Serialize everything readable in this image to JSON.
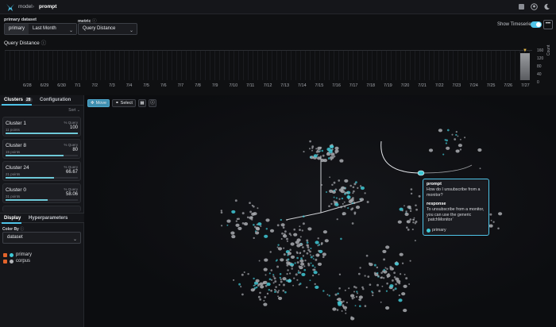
{
  "nav": {
    "breadcrumb": [
      "model",
      "prompt"
    ],
    "separator": "›"
  },
  "controls": {
    "primary_dataset_label": "primary dataset",
    "primary_tag": "primary",
    "primary_value": "Last Month",
    "metric_label": "metric",
    "metric_value": "Query Distance",
    "show_timeseries_label": "Show Timeseries",
    "show_timeseries_on": true,
    "more_label": "•••"
  },
  "timeseries": {
    "title": "Query Distance",
    "ticks": [
      "6/28",
      "6/29",
      "6/30",
      "7/1",
      "7/2",
      "7/3",
      "7/4",
      "7/5",
      "7/6",
      "7/7",
      "7/8",
      "7/9",
      "7/10",
      "7/11",
      "7/12",
      "7/13",
      "7/14",
      "7/15",
      "7/16",
      "7/17",
      "7/18",
      "7/19",
      "7/20",
      "7/21",
      "7/22",
      "7/23",
      "7/24",
      "7/25",
      "7/26",
      "7/27"
    ],
    "y_ticks": [
      "160",
      "120",
      "80",
      "40",
      "0"
    ],
    "y_label": "Count"
  },
  "left": {
    "tabs": [
      {
        "label": "Clusters",
        "badge": "28"
      },
      {
        "label": "Configuration"
      }
    ],
    "sort_label": "Sort",
    "clusters": [
      {
        "name": "Cluster 1",
        "points": "11 points",
        "q_label": "% Query",
        "q_value": "100",
        "fill": 1.0
      },
      {
        "name": "Cluster 8",
        "points": "15 points",
        "q_label": "% Query",
        "q_value": "80",
        "fill": 0.8
      },
      {
        "name": "Cluster 24",
        "points": "21 points",
        "q_label": "% Query",
        "q_value": "66.67",
        "fill": 0.6667
      },
      {
        "name": "Cluster 0",
        "points": "31 points",
        "q_label": "% Query",
        "q_value": "58.06",
        "fill": 0.5806
      }
    ],
    "bottom_tabs": [
      "Display",
      "Hyperparameters"
    ],
    "color_by_label": "Color By",
    "color_by_value": "dataset",
    "legend": [
      {
        "label": "primary",
        "color": "#3fc9d6"
      },
      {
        "label": "corpus",
        "color": "#b3b5b9"
      }
    ]
  },
  "view": {
    "tools": {
      "move": "Move",
      "select": "Select"
    },
    "tooltip": {
      "prompt_heading": "prompt",
      "prompt_text": "How do I unsubscribe from a monitor?",
      "response_heading": "response",
      "response_text": "To unsubscribe from a monitor, you can use the generic `patchMonitor`",
      "dataset": "primary"
    }
  },
  "colors": {
    "accent": "#4fc4e8",
    "primary_point": "#3fc9d6",
    "corpus_point": "#b3b5b9",
    "checkbox": "#e2632b"
  }
}
